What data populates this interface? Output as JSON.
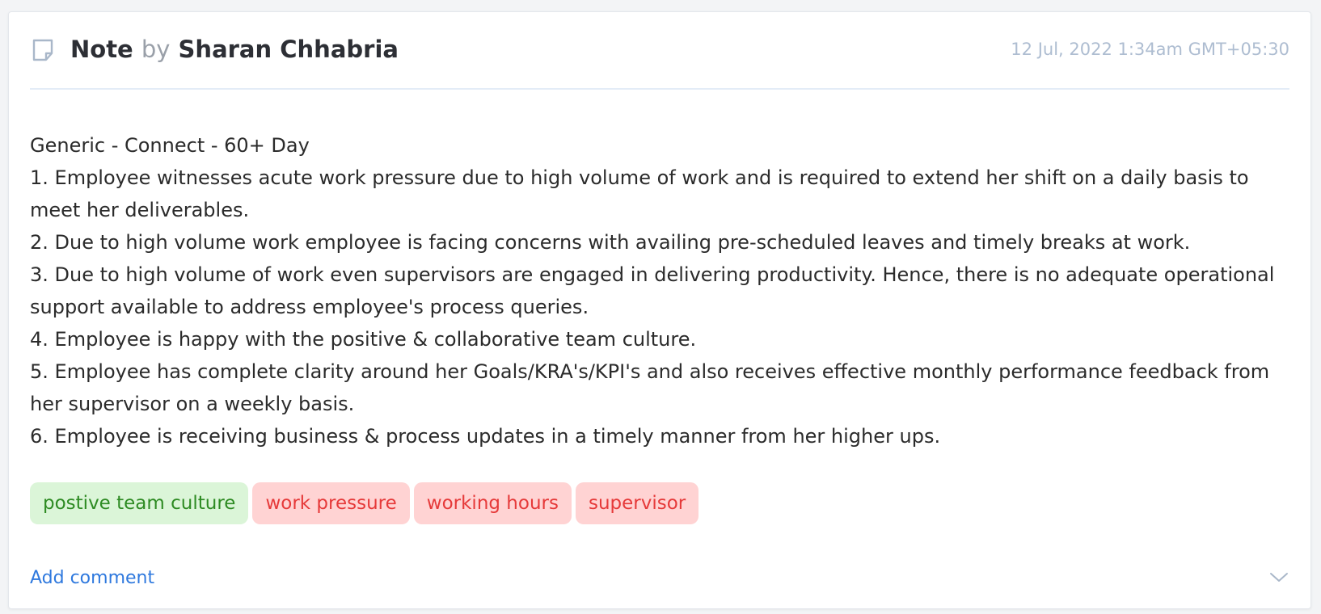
{
  "note": {
    "label": "Note",
    "by": "by",
    "author": "Sharan Chhabria",
    "timestamp": "12 Jul, 2022 1:34am GMT+05:30"
  },
  "content": {
    "lines": [
      "Generic - Connect - 60+ Day",
      "1. Employee witnesses acute work pressure due to high volume of work and is required to extend her shift on a daily basis to meet her deliverables.",
      "2. Due to high volume work employee is facing concerns with availing pre-scheduled leaves and timely breaks at work.",
      "3. Due to high volume of work even supervisors are engaged in delivering productivity. Hence, there is no adequate operational support available to address employee's process queries.",
      "4. Employee is happy with the positive & collaborative team culture.",
      "5. Employee has complete clarity around her Goals/KRA's/KPI's and also receives effective monthly performance feedback from her supervisor on a weekly basis.",
      "6. Employee is receiving business & process updates in a timely manner from her higher ups."
    ]
  },
  "tags": [
    {
      "label": "postive team culture",
      "sentiment": "positive"
    },
    {
      "label": "work pressure",
      "sentiment": "negative"
    },
    {
      "label": "working hours",
      "sentiment": "negative"
    },
    {
      "label": "supervisor",
      "sentiment": "negative"
    }
  ],
  "footer": {
    "add_comment_label": "Add comment"
  },
  "colors": {
    "positive_bg": "#dbf5d8",
    "positive_text": "#2e8b23",
    "negative_bg": "#ffd3d3",
    "negative_text": "#e63a3a",
    "link": "#2f79de",
    "timestamp": "#aebdd1"
  },
  "icons": {
    "note": "note-icon",
    "expand": "chevron-down-icon"
  }
}
